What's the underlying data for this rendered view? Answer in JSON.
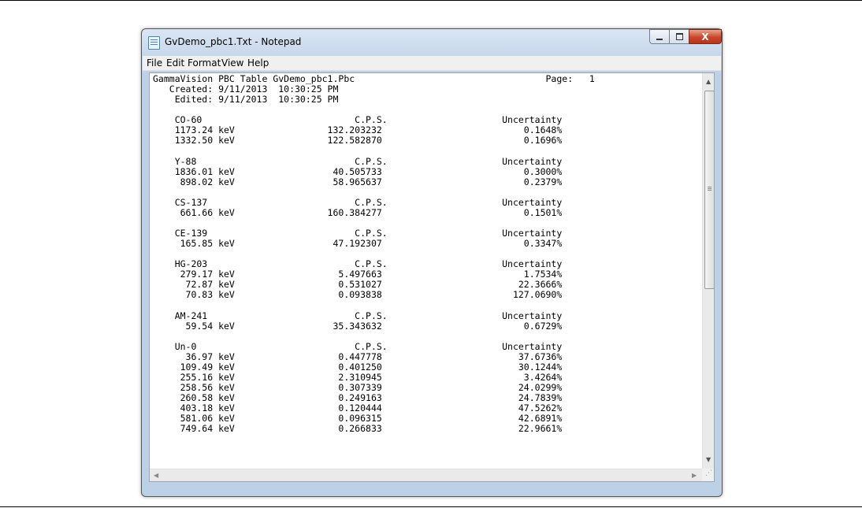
{
  "window": {
    "title": "GvDemo_pbc1.Txt - Notepad"
  },
  "menu": [
    "File",
    "Edit",
    "Format",
    "View",
    "Help"
  ],
  "document": {
    "lines": [
      "GammaVision PBC Table GvDemo_pbc1.Pbc                                   Page:   1",
      "   Created: 9/11/2013  10:30:25 PM",
      "    Edited: 9/11/2013  10:30:25 PM",
      "",
      "    CO-60                            C.P.S.                     Uncertainty",
      "    1173.24 keV                 132.203232                          0.1648%",
      "    1332.50 keV                 122.582870                          0.1696%",
      "",
      "    Y-88                             C.P.S.                     Uncertainty",
      "    1836.01 keV                  40.505733                          0.3000%",
      "     898.02 keV                  58.965637                          0.2379%",
      "",
      "    CS-137                           C.P.S.                     Uncertainty",
      "     661.66 keV                 160.384277                          0.1501%",
      "",
      "    CE-139                           C.P.S.                     Uncertainty",
      "     165.85 keV                  47.192307                          0.3347%",
      "",
      "    HG-203                           C.P.S.                     Uncertainty",
      "     279.17 keV                   5.497663                          1.7534%",
      "      72.87 keV                   0.531027                         22.3666%",
      "      70.83 keV                   0.093838                        127.0690%",
      "",
      "    AM-241                           C.P.S.                     Uncertainty",
      "      59.54 keV                  35.343632                          0.6729%",
      "",
      "    Un-0                             C.P.S.                     Uncertainty",
      "      36.97 keV                   0.447778                         37.6736%",
      "     109.49 keV                   0.401250                         30.1244%",
      "     255.16 keV                   2.310945                          3.4264%",
      "     258.56 keV                   0.307339                         24.0299%",
      "     260.58 keV                   0.249163                         24.7839%",
      "     403.18 keV                   0.120444                         47.5262%",
      "     581.06 keV                   0.096315                         42.6891%",
      "     749.64 keV                   0.266833                         22.9661%"
    ]
  },
  "icons": {
    "minimize": "minimize-icon",
    "maximize": "maximize-icon",
    "close": "close-icon",
    "close_glyph": "X",
    "app": "notepad-icon"
  },
  "colors": {
    "close_button": "#c9452b",
    "titlebar": "#c9d9ec"
  }
}
